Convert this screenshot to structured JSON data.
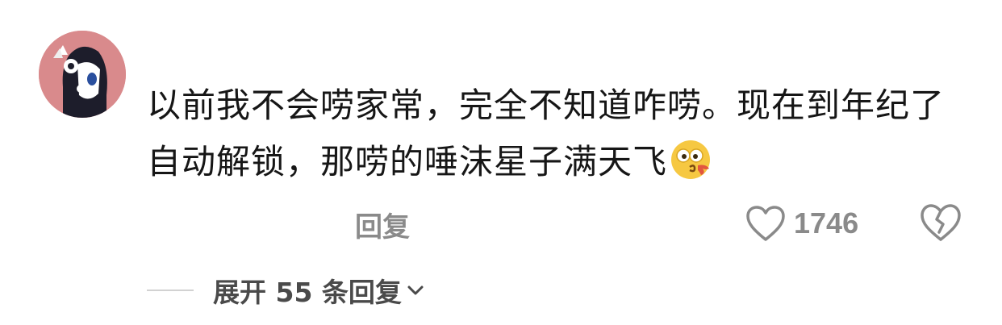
{
  "comment": {
    "text_line1": "以前我不会唠家常，完全不知道咋唠。现在到年纪了",
    "text_line2": "自动解锁，那唠的唾沫星子满天飞",
    "emoji_icon": "spitting-face-emoji"
  },
  "actions": {
    "reply_label": "回复",
    "like_count": "1746",
    "like_icon": "heart-outline-icon",
    "dislike_icon": "broken-heart-icon"
  },
  "replies": {
    "expand_label": "展开 55 条回复",
    "expand_icon": "chevron-down-icon"
  },
  "colors": {
    "avatar_bg": "#d98a8c",
    "text": "#161616",
    "muted": "#8a8a8a"
  }
}
